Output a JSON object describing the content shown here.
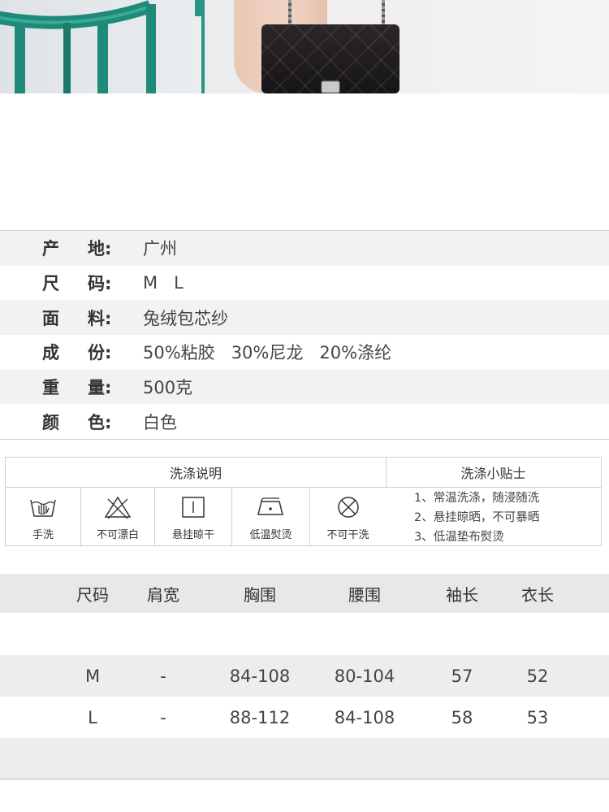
{
  "specs": [
    {
      "label_1": "产",
      "label_2": "地:",
      "value": "广州"
    },
    {
      "label_1": "尺",
      "label_2": "码:",
      "value": "M   L"
    },
    {
      "label_1": "面",
      "label_2": "料:",
      "value": "兔绒包芯纱"
    },
    {
      "label_1": "成",
      "label_2": "份:",
      "value": "50%粘胶   30%尼龙   20%涤纶"
    },
    {
      "label_1": "重",
      "label_2": "量:",
      "value": "500克"
    },
    {
      "label_1": "颜",
      "label_2": "色:",
      "value": "白色"
    }
  ],
  "wash": {
    "left_title": "洗涤说明",
    "right_title": "洗涤小贴士",
    "icons": [
      {
        "label": "手洗",
        "icon": "hand-wash-icon"
      },
      {
        "label": "不可漂白",
        "icon": "no-bleach-icon"
      },
      {
        "label": "悬挂晾干",
        "icon": "hang-dry-icon"
      },
      {
        "label": "低温熨烫",
        "icon": "low-iron-icon"
      },
      {
        "label": "不可干洗",
        "icon": "no-dry-clean-icon"
      }
    ],
    "tips": [
      "1、常温洗涤，随浸随洗",
      "2、悬挂晾晒，不可暴晒",
      "3、低温垫布熨烫"
    ]
  },
  "size_table": {
    "headers": [
      "尺码",
      "肩宽",
      "胸围",
      "腰围",
      "袖长",
      "衣长"
    ],
    "rows": [
      [
        "M",
        "-",
        "84-108",
        "80-104",
        "57",
        "52"
      ],
      [
        "L",
        "-",
        "88-112",
        "84-108",
        "58",
        "53"
      ]
    ]
  },
  "colors": {
    "stripe": "#f2f2f2",
    "header": "#e8e8e8",
    "border": "#cfcfcf",
    "chair": "#1f8a7a"
  }
}
